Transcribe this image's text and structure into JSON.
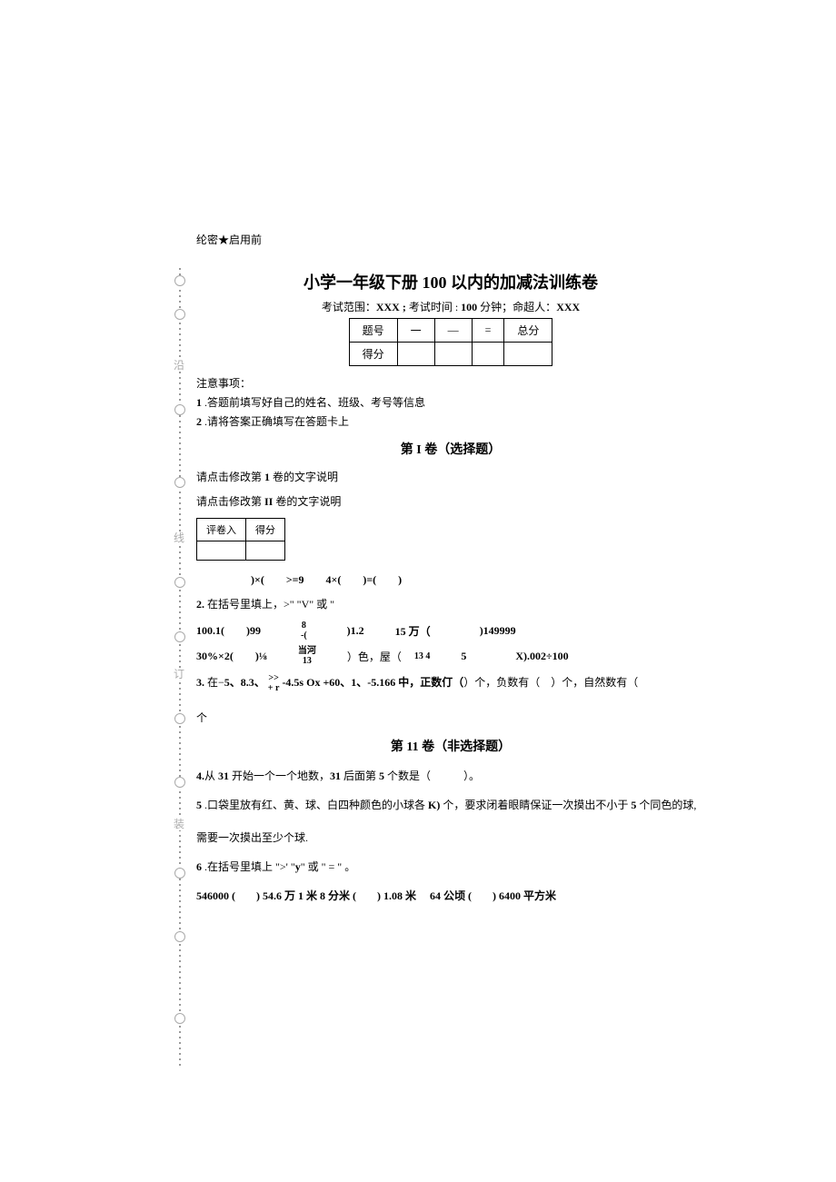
{
  "confidential": "纶密★启用前",
  "title": "小学一年级下册 100 以内的加减法训练卷",
  "subtitle_prefix": "考试范围：",
  "subtitle_range": "XXX ;",
  "subtitle_time_label": " 考试时间 : ",
  "subtitle_time": "100",
  "subtitle_time_unit": " 分钟；命超人：",
  "subtitle_author": "XXX",
  "score_headers": [
    "题号",
    "一",
    "—",
    "=",
    "总分"
  ],
  "score_row": "得分",
  "notice_header": "注意事项：",
  "notice1_num": "1",
  "notice1": " .答题前填写好自己的姓名、班级、考号等信息",
  "notice2_num": "2",
  "notice2": "  .请将答案正确填写在答题卡上",
  "section1": "第 I 卷（选择题）",
  "instr1_prefix": "请点击修改第 ",
  "instr1_num": "1",
  "instr1_suffix": " 卷的文字说明",
  "instr2_prefix": "请点击修改第 ",
  "instr2_num": "II",
  "instr2_suffix": " 卷的文字说明",
  "grader_h1": "评卷入",
  "grader_h2": "得分",
  "q1": ")×(　　>=9　　4×(　　)=(　　)",
  "q2h_num": "2.",
  "q2h": " 在括号里填上，>\" \"V\"  或 \"",
  "q2r1": {
    "a": "100.1(",
    "b": ")99",
    "c_num": "8",
    "c_den": "-(",
    "d": ")1.2",
    "e": "15 万（",
    "f": ")149999"
  },
  "q2r2": {
    "a": "30%×2(",
    "b": ")⅛",
    "c_top": "当河",
    "c_bot": "13",
    "d": "）色，屋（",
    "e_top": "13 4",
    "f": "5",
    "g": "X).002÷100"
  },
  "q3_num": "3.",
  "q3_a": " 在−",
  "q3_b": "5、8.3、",
  "q3_c_top": ">>",
  "q3_c_bot": "+ r",
  "q3_d": " -4.5s Ox +60、1、-5.166 中，正数仃（",
  "q3_e": "）个，负数有（　）个，自然数有（",
  "q3_f": "个",
  "section2": "第 11 卷（非选择题）",
  "q4_num": "4.",
  "q4_a": "从 ",
  "q4_b": "31",
  "q4_c": " 开始一个一个地数，",
  "q4_d": "31",
  "q4_e": " 后面第 ",
  "q4_f": "5",
  "q4_g": " 个数是（　　　）。",
  "q5_num": "5",
  "q5_a": "   .口袋里放有红、黄、球、白四种颜色的小球各 ",
  "q5_b": "K)",
  "q5_c": " 个，要求闭着眼睛保证一次摸出不小于 ",
  "q5_d": "5",
  "q5_e": " 个同色的球,",
  "q5_f": "需要一次摸出至少个球.",
  "q6_num": "6",
  "q6_a": "  .在括号里填上 \">'  \"",
  "q6_b": "y",
  "q6_c": "\" 或 \" = \"  。",
  "q7_a": "546000 (",
  "q7_b": ") 54.6 万 1 米 8 分米 (",
  "q7_c": ") 1.08 米　 64 公顷 (",
  "q7_d": ") 6400 平方米",
  "binding_chars": [
    "沿",
    "线",
    "装"
  ]
}
